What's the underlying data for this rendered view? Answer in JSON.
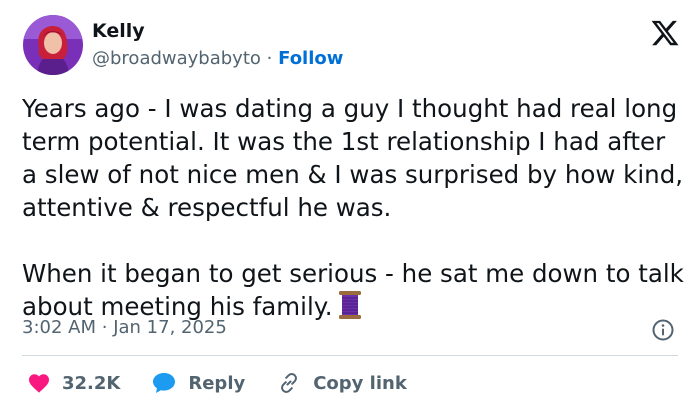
{
  "author": {
    "name": "Kelly",
    "handle": "@broadwaybabyto",
    "separator": "·",
    "follow_label": "Follow"
  },
  "icons": {
    "brand": "x-logo-icon",
    "info": "info-icon",
    "like": "heart-icon",
    "reply": "speech-bubble-icon",
    "copy_link": "link-icon",
    "inline_emoji": "thread-spool-emoji"
  },
  "tweet": {
    "paragraph_1": "Years ago - I was dating a guy I thought had real long term potential. It was the 1st relationship I had after a slew of not nice men & I was surprised by how kind, attentive & respectful he was.",
    "paragraph_2": "When it began to get serious - he sat me down to talk about meeting his family.",
    "time": "3:02 AM",
    "date_separator": "·",
    "date": "Jan 17, 2025"
  },
  "actions": {
    "like_count": "32.2K",
    "reply_label": "Reply",
    "copy_link_label": "Copy link"
  },
  "colors": {
    "text": "#0f1419",
    "secondary": "#536471",
    "follow": "#006fd6",
    "like": "#f91880",
    "reply": "#1d9bf0",
    "divider": "#cfd9de",
    "avatar_bg": "#8a3fc9",
    "avatar_hair": "#c8203a"
  }
}
